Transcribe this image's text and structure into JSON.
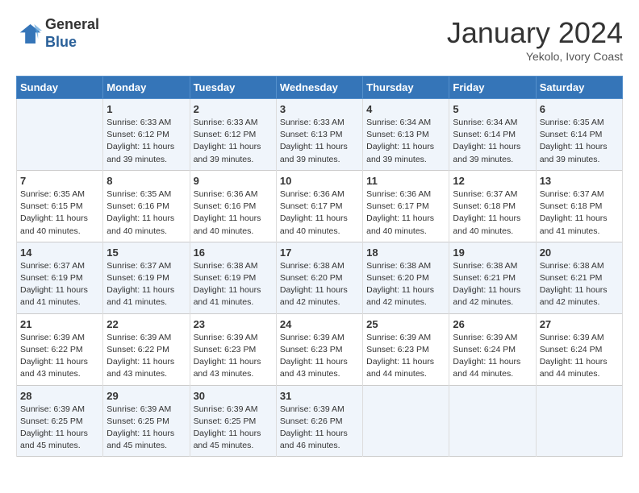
{
  "header": {
    "logo_line1": "General",
    "logo_line2": "Blue",
    "month": "January 2024",
    "location": "Yekolo, Ivory Coast"
  },
  "weekdays": [
    "Sunday",
    "Monday",
    "Tuesday",
    "Wednesday",
    "Thursday",
    "Friday",
    "Saturday"
  ],
  "weeks": [
    [
      {
        "day": "",
        "content": ""
      },
      {
        "day": "1",
        "content": "Sunrise: 6:33 AM\nSunset: 6:12 PM\nDaylight: 11 hours\nand 39 minutes."
      },
      {
        "day": "2",
        "content": "Sunrise: 6:33 AM\nSunset: 6:12 PM\nDaylight: 11 hours\nand 39 minutes."
      },
      {
        "day": "3",
        "content": "Sunrise: 6:33 AM\nSunset: 6:13 PM\nDaylight: 11 hours\nand 39 minutes."
      },
      {
        "day": "4",
        "content": "Sunrise: 6:34 AM\nSunset: 6:13 PM\nDaylight: 11 hours\nand 39 minutes."
      },
      {
        "day": "5",
        "content": "Sunrise: 6:34 AM\nSunset: 6:14 PM\nDaylight: 11 hours\nand 39 minutes."
      },
      {
        "day": "6",
        "content": "Sunrise: 6:35 AM\nSunset: 6:14 PM\nDaylight: 11 hours\nand 39 minutes."
      }
    ],
    [
      {
        "day": "7",
        "content": "Sunrise: 6:35 AM\nSunset: 6:15 PM\nDaylight: 11 hours\nand 40 minutes."
      },
      {
        "day": "8",
        "content": "Sunrise: 6:35 AM\nSunset: 6:16 PM\nDaylight: 11 hours\nand 40 minutes."
      },
      {
        "day": "9",
        "content": "Sunrise: 6:36 AM\nSunset: 6:16 PM\nDaylight: 11 hours\nand 40 minutes."
      },
      {
        "day": "10",
        "content": "Sunrise: 6:36 AM\nSunset: 6:17 PM\nDaylight: 11 hours\nand 40 minutes."
      },
      {
        "day": "11",
        "content": "Sunrise: 6:36 AM\nSunset: 6:17 PM\nDaylight: 11 hours\nand 40 minutes."
      },
      {
        "day": "12",
        "content": "Sunrise: 6:37 AM\nSunset: 6:18 PM\nDaylight: 11 hours\nand 40 minutes."
      },
      {
        "day": "13",
        "content": "Sunrise: 6:37 AM\nSunset: 6:18 PM\nDaylight: 11 hours\nand 41 minutes."
      }
    ],
    [
      {
        "day": "14",
        "content": "Sunrise: 6:37 AM\nSunset: 6:19 PM\nDaylight: 11 hours\nand 41 minutes."
      },
      {
        "day": "15",
        "content": "Sunrise: 6:37 AM\nSunset: 6:19 PM\nDaylight: 11 hours\nand 41 minutes."
      },
      {
        "day": "16",
        "content": "Sunrise: 6:38 AM\nSunset: 6:19 PM\nDaylight: 11 hours\nand 41 minutes."
      },
      {
        "day": "17",
        "content": "Sunrise: 6:38 AM\nSunset: 6:20 PM\nDaylight: 11 hours\nand 42 minutes."
      },
      {
        "day": "18",
        "content": "Sunrise: 6:38 AM\nSunset: 6:20 PM\nDaylight: 11 hours\nand 42 minutes."
      },
      {
        "day": "19",
        "content": "Sunrise: 6:38 AM\nSunset: 6:21 PM\nDaylight: 11 hours\nand 42 minutes."
      },
      {
        "day": "20",
        "content": "Sunrise: 6:38 AM\nSunset: 6:21 PM\nDaylight: 11 hours\nand 42 minutes."
      }
    ],
    [
      {
        "day": "21",
        "content": "Sunrise: 6:39 AM\nSunset: 6:22 PM\nDaylight: 11 hours\nand 43 minutes."
      },
      {
        "day": "22",
        "content": "Sunrise: 6:39 AM\nSunset: 6:22 PM\nDaylight: 11 hours\nand 43 minutes."
      },
      {
        "day": "23",
        "content": "Sunrise: 6:39 AM\nSunset: 6:23 PM\nDaylight: 11 hours\nand 43 minutes."
      },
      {
        "day": "24",
        "content": "Sunrise: 6:39 AM\nSunset: 6:23 PM\nDaylight: 11 hours\nand 43 minutes."
      },
      {
        "day": "25",
        "content": "Sunrise: 6:39 AM\nSunset: 6:23 PM\nDaylight: 11 hours\nand 44 minutes."
      },
      {
        "day": "26",
        "content": "Sunrise: 6:39 AM\nSunset: 6:24 PM\nDaylight: 11 hours\nand 44 minutes."
      },
      {
        "day": "27",
        "content": "Sunrise: 6:39 AM\nSunset: 6:24 PM\nDaylight: 11 hours\nand 44 minutes."
      }
    ],
    [
      {
        "day": "28",
        "content": "Sunrise: 6:39 AM\nSunset: 6:25 PM\nDaylight: 11 hours\nand 45 minutes."
      },
      {
        "day": "29",
        "content": "Sunrise: 6:39 AM\nSunset: 6:25 PM\nDaylight: 11 hours\nand 45 minutes."
      },
      {
        "day": "30",
        "content": "Sunrise: 6:39 AM\nSunset: 6:25 PM\nDaylight: 11 hours\nand 45 minutes."
      },
      {
        "day": "31",
        "content": "Sunrise: 6:39 AM\nSunset: 6:26 PM\nDaylight: 11 hours\nand 46 minutes."
      },
      {
        "day": "",
        "content": ""
      },
      {
        "day": "",
        "content": ""
      },
      {
        "day": "",
        "content": ""
      }
    ]
  ]
}
